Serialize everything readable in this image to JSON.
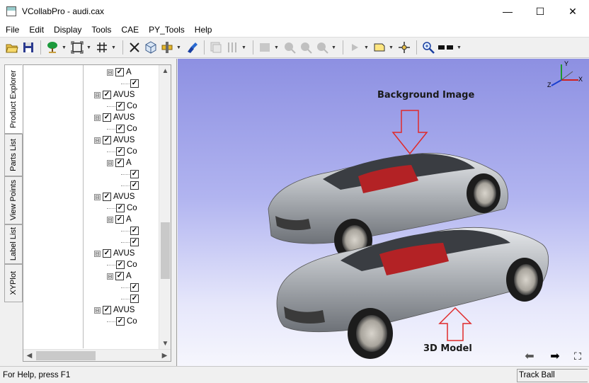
{
  "window": {
    "title": "VCollabPro - audi.cax",
    "minimize": "—",
    "maximize": "☐",
    "close": "✕"
  },
  "menu": [
    "File",
    "Edit",
    "Display",
    "Tools",
    "CAE",
    "PY_Tools",
    "Help"
  ],
  "toolbar_icons": [
    "open-folder-icon",
    "save-icon",
    "tree-icon",
    "fit-view-icon",
    "grid-icon",
    "cross-arrows-icon",
    "cube-icon",
    "section-plane-icon",
    "brush-icon",
    "layers-icon",
    "transparency-icon",
    "image-icon",
    "zoom-in-icon",
    "zoom-out-icon",
    "zoom-select-icon",
    "play-icon",
    "note-icon",
    "center-point-icon",
    "magnifier-icon",
    "dash-display-icon"
  ],
  "left_tabs": [
    "Product Explorer",
    "Parts List",
    "View Points",
    "Label List",
    "XYPlot"
  ],
  "tree": {
    "rows": [
      {
        "level": 2,
        "expander": "⊟",
        "checked": true,
        "label": "A"
      },
      {
        "level": 3,
        "expander": "",
        "checked": true,
        "label": ""
      },
      {
        "level": 1,
        "expander": "⊟",
        "checked": true,
        "label": "AVUS"
      },
      {
        "level": 2,
        "expander": "",
        "checked": true,
        "label": "Co"
      },
      {
        "level": 1,
        "expander": "⊟",
        "checked": true,
        "label": "AVUS"
      },
      {
        "level": 2,
        "expander": "",
        "checked": true,
        "label": "Co"
      },
      {
        "level": 1,
        "expander": "⊟",
        "checked": true,
        "label": "AVUS"
      },
      {
        "level": 2,
        "expander": "",
        "checked": true,
        "label": "Co"
      },
      {
        "level": 2,
        "expander": "⊟",
        "checked": true,
        "label": "A"
      },
      {
        "level": 3,
        "expander": "",
        "checked": true,
        "label": ""
      },
      {
        "level": 3,
        "expander": "",
        "checked": true,
        "label": ""
      },
      {
        "level": 1,
        "expander": "⊟",
        "checked": true,
        "label": "AVUS"
      },
      {
        "level": 2,
        "expander": "",
        "checked": true,
        "label": "Co"
      },
      {
        "level": 2,
        "expander": "⊟",
        "checked": true,
        "label": "A"
      },
      {
        "level": 3,
        "expander": "",
        "checked": true,
        "label": ""
      },
      {
        "level": 3,
        "expander": "",
        "checked": true,
        "label": ""
      },
      {
        "level": 1,
        "expander": "⊟",
        "checked": true,
        "label": "AVUS"
      },
      {
        "level": 2,
        "expander": "",
        "checked": true,
        "label": "Co"
      },
      {
        "level": 2,
        "expander": "⊟",
        "checked": true,
        "label": "A"
      },
      {
        "level": 3,
        "expander": "",
        "checked": true,
        "label": ""
      },
      {
        "level": 3,
        "expander": "",
        "checked": true,
        "label": ""
      },
      {
        "level": 1,
        "expander": "⊟",
        "checked": true,
        "label": "AVUS"
      },
      {
        "level": 2,
        "expander": "",
        "checked": true,
        "label": "Co"
      }
    ]
  },
  "viewport": {
    "annotation_top": "Background Image",
    "annotation_bottom": "3D Model",
    "axes": {
      "x": "X",
      "y": "Y",
      "z": "Z"
    },
    "nav_prev": "⬅",
    "nav_next": "➡",
    "fullscreen": "⛶"
  },
  "status": {
    "help_text": "For Help, press F1",
    "mode": "Track Ball"
  },
  "colors": {
    "viewport_top": "#8d90e2",
    "viewport_bottom": "#f6f6fd",
    "car_body": "#b4b8bd",
    "car_interior": "#c0282a",
    "arrow_outline": "#e02a2a"
  }
}
